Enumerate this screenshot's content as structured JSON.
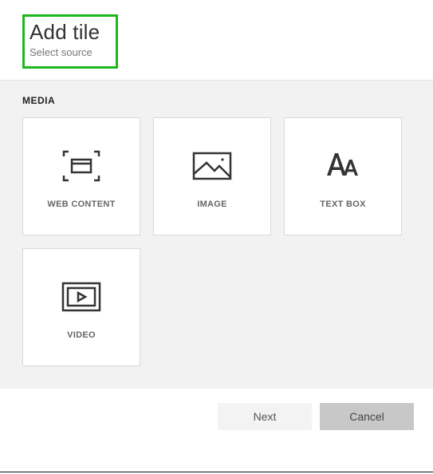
{
  "header": {
    "title": "Add tile",
    "subtitle": "Select source"
  },
  "section": {
    "label": "MEDIA"
  },
  "tiles": [
    {
      "label": "WEB CONTENT"
    },
    {
      "label": "IMAGE"
    },
    {
      "label": "TEXT BOX"
    },
    {
      "label": "VIDEO"
    }
  ],
  "buttons": {
    "next": "Next",
    "cancel": "Cancel"
  },
  "colors": {
    "highlight_border": "#1db81d",
    "panel_bg": "#f2f2f2",
    "tile_bg": "#ffffff",
    "tile_border": "#d9d9d9",
    "icon_stroke": "#333333"
  }
}
